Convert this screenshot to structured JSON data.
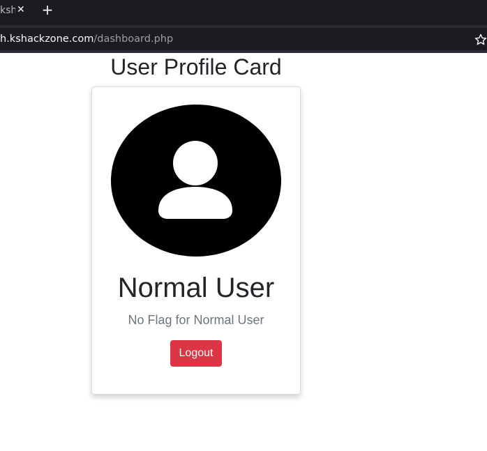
{
  "browser": {
    "tab": {
      "title": "ksh",
      "close_icon": "close-icon"
    },
    "new_tab_icon": "plus-icon",
    "url": {
      "host": "h.kshackzone.com",
      "path": "/dashboard.php"
    },
    "bookmark_icon": "star-icon",
    "colors": {
      "tabbar_bg": "#1c1b22",
      "toolbar_bg": "#2b2a33"
    }
  },
  "page": {
    "heading": "User Profile Card",
    "card": {
      "avatar_icon": "user-avatar-icon",
      "name": "Normal User",
      "subtitle": "No Flag for Normal User",
      "logout_label": "Logout"
    },
    "colors": {
      "danger": "#dc3545",
      "text": "#212529",
      "muted": "#6c757d"
    }
  }
}
